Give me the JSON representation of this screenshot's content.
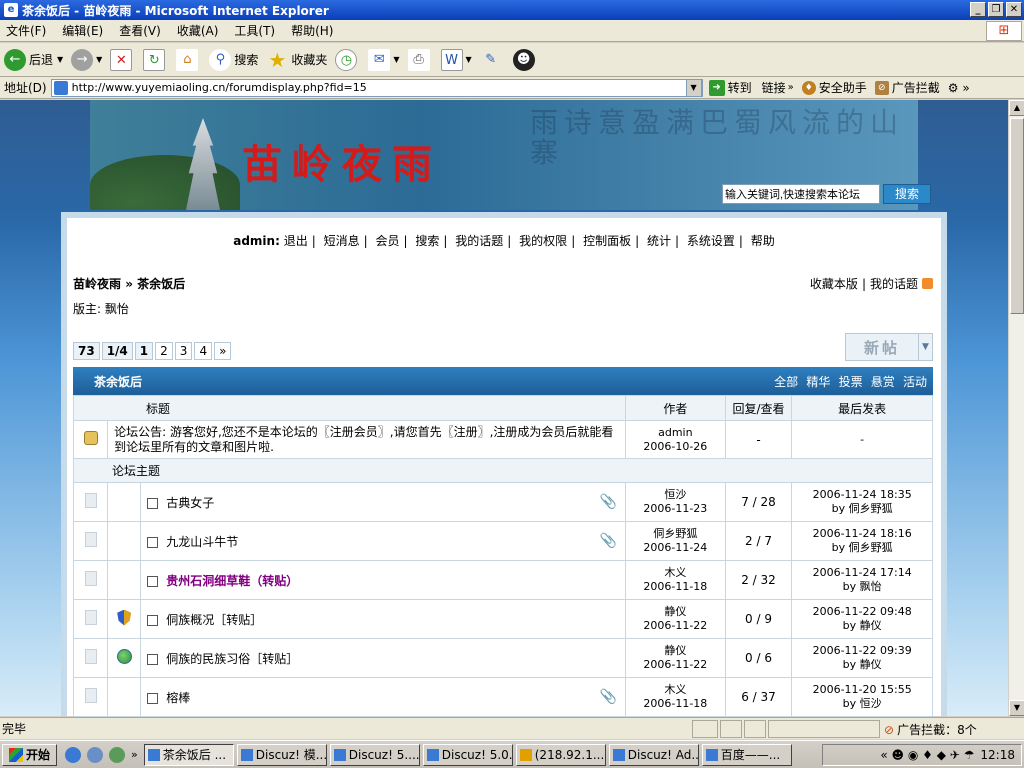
{
  "window": {
    "title": "茶余饭后 - 苗岭夜雨 - Microsoft Internet Explorer"
  },
  "menu": [
    "文件(F)",
    "编辑(E)",
    "查看(V)",
    "收藏(A)",
    "工具(T)",
    "帮助(H)"
  ],
  "toolbar": {
    "back": "后退",
    "search": "搜索",
    "favorites": "收藏夹"
  },
  "address": {
    "label": "地址(D)",
    "url": "http://www.yuyemiaoling.cn/forumdisplay.php?fid=15",
    "go": "转到",
    "links": "链接",
    "safety": "安全助手",
    "adblock": "广告拦截"
  },
  "banner": {
    "logo": "苗岭夜雨",
    "calligraphy": "雨诗意盈满巴蜀风流的山寨"
  },
  "usernav": {
    "user": "admin:",
    "links": [
      "退出",
      "短消息",
      "会员",
      "搜索",
      "我的话题",
      "我的权限",
      "控制面板",
      "统计",
      "系统设置",
      "帮助"
    ]
  },
  "breadcrumb": {
    "home": "苗岭夜雨",
    "sep": "»",
    "forum": "茶余饭后"
  },
  "moderator": "版主: 飘怡",
  "rightlinks": {
    "fav": "收藏本版",
    "mytopics": "我的话题"
  },
  "search": {
    "placeholder": "输入关键词,快速搜索本论坛",
    "button": "搜索"
  },
  "pagination": {
    "total": "73",
    "pages": "1/4",
    "items": [
      "1",
      "2",
      "3",
      "4",
      "»"
    ]
  },
  "newpost": "新帖",
  "forum": {
    "title": "茶余饭后",
    "filters": [
      "全部",
      "精华",
      "投票",
      "悬赏",
      "活动"
    ]
  },
  "columns": {
    "subject": "标题",
    "author": "作者",
    "replies": "回复/查看",
    "last": "最后发表"
  },
  "notice": {
    "text": "论坛公告: 游客您好,您还不是本论坛的〖注册会员〗,请您首先〖注册〗,注册成为会员后就能看到论坛里所有的文章和图片啦.",
    "author": "admin",
    "date": "2006-10-26",
    "replies": "-",
    "last": "-"
  },
  "section": "论坛主题",
  "threads": [
    {
      "title": "古典女子",
      "author": "恒沙",
      "date": "2006-11-23",
      "replies": "7 / 28",
      "last_time": "2006-11-24 18:35",
      "last_by": "by 侗乡野狐"
    },
    {
      "title": "九龙山斗牛节",
      "author": "侗乡野狐",
      "date": "2006-11-24",
      "replies": "2 / 7",
      "last_time": "2006-11-24 18:16",
      "last_by": "by 侗乡野狐"
    },
    {
      "title": "贵州石洞细草鞋（转贴）",
      "author": "木义",
      "date": "2006-11-18",
      "replies": "2 / 32",
      "last_time": "2006-11-24 17:14",
      "last_by": "by 飘怡"
    },
    {
      "title": "侗族概况［转贴］",
      "author": "静仪",
      "date": "2006-11-22",
      "replies": "0 / 9",
      "last_time": "2006-11-22 09:48",
      "last_by": "by 静仪"
    },
    {
      "title": "侗族的民族习俗［转贴］",
      "author": "静仪",
      "date": "2006-11-22",
      "replies": "0 / 6",
      "last_time": "2006-11-22 09:39",
      "last_by": "by 静仪"
    },
    {
      "title": "榕棒",
      "author": "木义",
      "date": "2006-11-18",
      "replies": "6 / 37",
      "last_time": "2006-11-20 15:55",
      "last_by": "by 恒沙"
    }
  ],
  "status": {
    "left": "完毕",
    "adblock": "广告拦截：8个"
  },
  "taskbar": {
    "start": "开始",
    "tasks": [
      "茶余饭后 ...",
      "Discuz! 模...",
      "Discuz! 5....",
      "Discuz! 5.0...",
      "(218.92.1...",
      "Discuz! Ad...",
      "百度——..."
    ],
    "clock": "12:18"
  }
}
